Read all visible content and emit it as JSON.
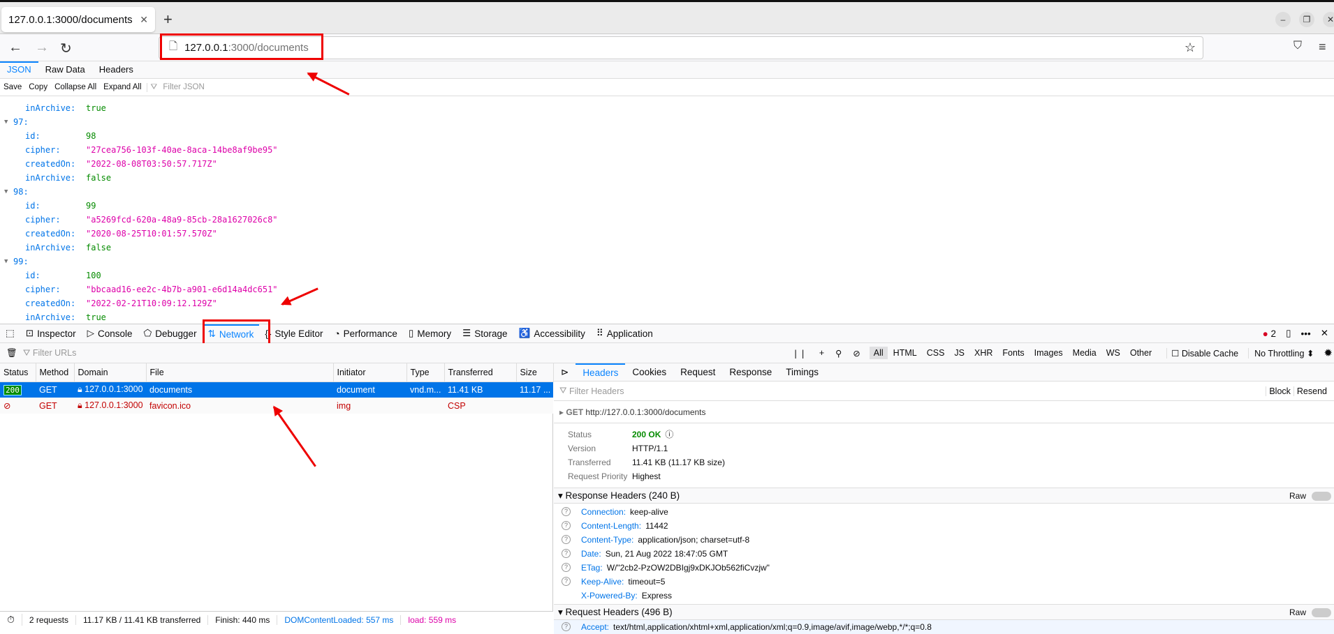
{
  "browser": {
    "tab_title": "127.0.0.1:3000/documents",
    "url_host": "127.0.0.1",
    "url_path": ":3000/documents"
  },
  "json_viewer": {
    "tabs": [
      "JSON",
      "Raw Data",
      "Headers"
    ],
    "toolbar": [
      "Save",
      "Copy",
      "Collapse All",
      "Expand All"
    ],
    "filter_placeholder": "Filter JSON",
    "rows": [
      {
        "type": "prop",
        "key": "inArchive:",
        "value": "true",
        "vtype": "bool"
      },
      {
        "type": "idx",
        "key": "97:"
      },
      {
        "type": "prop",
        "key": "id:",
        "value": "98",
        "vtype": "num"
      },
      {
        "type": "prop",
        "key": "cipher:",
        "value": "\"27cea756-103f-40ae-8aca-14be8af9be95\"",
        "vtype": "str"
      },
      {
        "type": "prop",
        "key": "createdOn:",
        "value": "\"2022-08-08T03:50:57.717Z\"",
        "vtype": "str"
      },
      {
        "type": "prop",
        "key": "inArchive:",
        "value": "false",
        "vtype": "bool"
      },
      {
        "type": "idx",
        "key": "98:"
      },
      {
        "type": "prop",
        "key": "id:",
        "value": "99",
        "vtype": "num"
      },
      {
        "type": "prop",
        "key": "cipher:",
        "value": "\"a5269fcd-620a-48a9-85cb-28a1627026c8\"",
        "vtype": "str"
      },
      {
        "type": "prop",
        "key": "createdOn:",
        "value": "\"2020-08-25T10:01:57.570Z\"",
        "vtype": "str"
      },
      {
        "type": "prop",
        "key": "inArchive:",
        "value": "false",
        "vtype": "bool"
      },
      {
        "type": "idx",
        "key": "99:"
      },
      {
        "type": "prop",
        "key": "id:",
        "value": "100",
        "vtype": "num"
      },
      {
        "type": "prop",
        "key": "cipher:",
        "value": "\"bbcaad16-ee2c-4b7b-a901-e6d14a4dc651\"",
        "vtype": "str"
      },
      {
        "type": "prop",
        "key": "createdOn:",
        "value": "\"2022-02-21T10:09:12.129Z\"",
        "vtype": "str"
      },
      {
        "type": "prop",
        "key": "inArchive:",
        "value": "true",
        "vtype": "bool"
      }
    ]
  },
  "devtools": {
    "tools": [
      {
        "label": "Inspector",
        "icon": "inspector-icon",
        "g": "⊡"
      },
      {
        "label": "Console",
        "icon": "console-icon",
        "g": "▷"
      },
      {
        "label": "Debugger",
        "icon": "debugger-icon",
        "g": "⬠"
      },
      {
        "label": "Network",
        "icon": "network-icon",
        "g": "⇅",
        "selected": true
      },
      {
        "label": "Style Editor",
        "icon": "style-editor-icon",
        "g": "{}"
      },
      {
        "label": "Performance",
        "icon": "performance-icon",
        "g": "◔"
      },
      {
        "label": "Memory",
        "icon": "memory-icon",
        "g": "▯"
      },
      {
        "label": "Storage",
        "icon": "storage-icon",
        "g": "☰"
      },
      {
        "label": "Accessibility",
        "icon": "accessibility-icon",
        "g": "♿"
      },
      {
        "label": "Application",
        "icon": "application-icon",
        "g": "⠿"
      }
    ],
    "error_count": "2",
    "filter_placeholder": "Filter URLs",
    "type_filters": [
      "All",
      "HTML",
      "CSS",
      "JS",
      "XHR",
      "Fonts",
      "Images",
      "Media",
      "WS",
      "Other"
    ],
    "disable_cache": "Disable Cache",
    "throttling": "No Throttling",
    "columns": [
      "Status",
      "Method",
      "Domain",
      "File",
      "Initiator",
      "Type",
      "Transferred",
      "Size"
    ],
    "requests": [
      {
        "status": "200",
        "method": "GET",
        "domain": "127.0.0.1:3000",
        "file": "documents",
        "initiator": "document",
        "type": "vnd.m...",
        "transferred": "11.41 KB",
        "size": "11.17 ..."
      },
      {
        "status": "blocked",
        "method": "GET",
        "domain": "127.0.0.1:3000",
        "file": "favicon.ico",
        "initiator": "img",
        "type": "",
        "transferred": "CSP",
        "size": ""
      }
    ],
    "statusbar": {
      "requests": "2 requests",
      "transferred": "11.17 KB / 11.41 KB transferred",
      "finish": "Finish: 440 ms",
      "dcl": "DOMContentLoaded: 557 ms",
      "load": "load: 559 ms"
    },
    "details": {
      "tabs": [
        "Headers",
        "Cookies",
        "Request",
        "Response",
        "Timings"
      ],
      "filter_placeholder": "Filter Headers",
      "block": "Block",
      "resend": "Resend",
      "method": "GET",
      "url": "http://127.0.0.1:3000/documents",
      "summary": [
        {
          "label": "Status",
          "value": "200 OK"
        },
        {
          "label": "Version",
          "value": "HTTP/1.1"
        },
        {
          "label": "Transferred",
          "value": "11.41 KB (11.17 KB size)"
        },
        {
          "label": "Request Priority",
          "value": "Highest"
        }
      ],
      "response_title": "Response Headers (240 B)",
      "raw": "Raw",
      "response_headers": [
        {
          "k": "Connection:",
          "v": "keep-alive"
        },
        {
          "k": "Content-Length:",
          "v": "11442"
        },
        {
          "k": "Content-Type:",
          "v": "application/json; charset=utf-8"
        },
        {
          "k": "Date:",
          "v": "Sun, 21 Aug 2022 18:47:05 GMT"
        },
        {
          "k": "ETag:",
          "v": "W/\"2cb2-PzOW2DBIgj9xDKJOb562fiCvzjw\""
        },
        {
          "k": "Keep-Alive:",
          "v": "timeout=5"
        },
        {
          "k": "X-Powered-By:",
          "v": "Express"
        }
      ],
      "request_title": "Request Headers (496 B)",
      "request_headers": [
        {
          "k": "Accept:",
          "v": "text/html,application/xhtml+xml,application/xml;q=0.9,image/avif,image/webp,*/*;q=0.8"
        }
      ]
    }
  },
  "colors": {
    "accent": "#0a84ff",
    "annotation": "#e00000",
    "string": "#dd00a9",
    "number": "#058b00"
  }
}
